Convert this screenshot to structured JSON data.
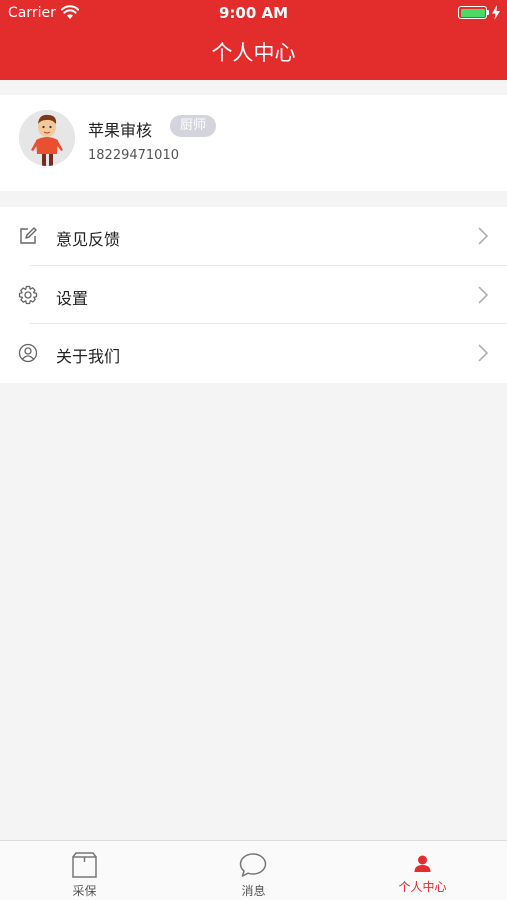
{
  "status": {
    "carrier": "Carrier",
    "time": "9:00 AM"
  },
  "header": {
    "title": "个人中心"
  },
  "profile": {
    "name": "苹果审核",
    "role": "厨师",
    "phone": "18229471010"
  },
  "menu": [
    {
      "label": "意见反馈",
      "icon": "edit-icon"
    },
    {
      "label": "设置",
      "icon": "gear-icon"
    },
    {
      "label": "关于我们",
      "icon": "user-circle-icon"
    }
  ],
  "tabs": [
    {
      "label": "采保",
      "icon": "box-icon",
      "active": false
    },
    {
      "label": "消息",
      "icon": "chat-bubble-icon",
      "active": false
    },
    {
      "label": "个人中心",
      "icon": "person-icon",
      "active": true
    }
  ],
  "colors": {
    "accent": "#e32d2d",
    "badge": "#d4d4dc",
    "battery": "#4cd964"
  }
}
